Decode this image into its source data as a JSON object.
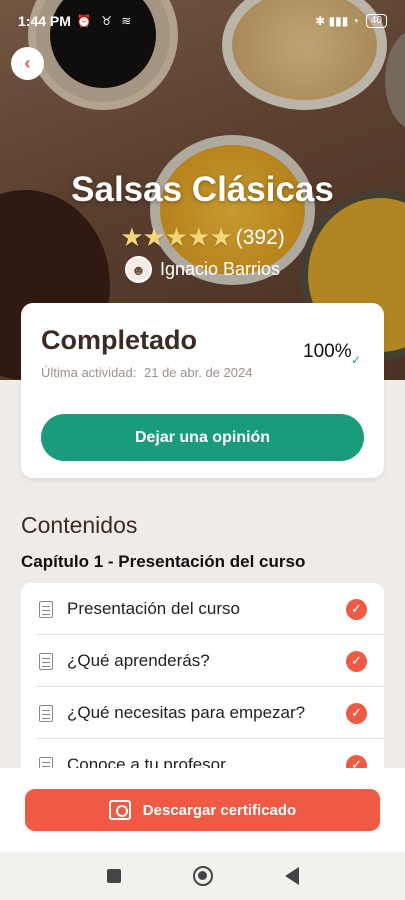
{
  "status_bar": {
    "time": "1:44 PM",
    "left_icons": "⏰ ♉ ≋",
    "right_icons": "✱ ▮▮▮ ◔",
    "battery": "40"
  },
  "hero": {
    "title": "Salsas Clásicas",
    "stars": "★★★★★",
    "rating_count": "(392)",
    "author": "Ignacio Barrios",
    "back_icon": "chevron-left-icon"
  },
  "progress_card": {
    "status": "Completado",
    "percent": "100%",
    "progress_fraction": 1.0,
    "last_activity_label": "Última actividad:",
    "last_activity_date": "21 de abr. de 2024",
    "review_button": "Dejar una opinión"
  },
  "contents": {
    "title": "Contenidos",
    "chapter_title": "Capítulo 1 - Presentación del curso",
    "lessons": [
      {
        "label": "Presentación del curso",
        "completed": true
      },
      {
        "label": "¿Qué aprenderás?",
        "completed": true
      },
      {
        "label": "¿Qué necesitas para empezar?",
        "completed": true
      },
      {
        "label": "Conoce a tu profesor",
        "completed": true
      }
    ]
  },
  "footer": {
    "certificate_button": "Descargar certificado"
  },
  "colors": {
    "accent_red": "#ef5a44",
    "accent_green": "#1a9b7b",
    "background": "#efebe8"
  }
}
